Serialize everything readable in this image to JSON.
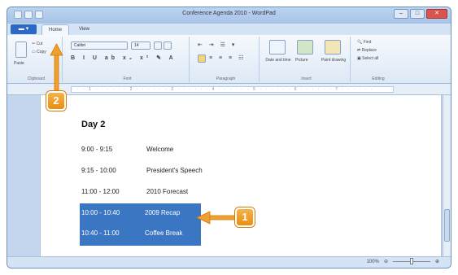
{
  "window": {
    "title": "Conference Agenda 2010 - WordPad"
  },
  "tabs": [
    "Home",
    "View"
  ],
  "app_button": "▬ ▾",
  "ribbon": {
    "clipboard": {
      "paste": "Paste",
      "cut": "Cut",
      "copy": "Copy",
      "label": "Clipboard"
    },
    "font": {
      "name": "Calibri",
      "size": "14",
      "label": "Font"
    },
    "paragraph": {
      "label": "Paragraph"
    },
    "insert": {
      "datetime": "Date and time",
      "picture": "Picture",
      "paint": "Paint drawing",
      "label": "Insert"
    },
    "editing": {
      "find": "Find",
      "replace": "Replace",
      "select_all": "Select all",
      "label": "Editing"
    }
  },
  "document": {
    "heading": "Day 2",
    "rows": [
      {
        "time": "9:00 - 9:15",
        "event": "Welcome"
      },
      {
        "time": "9:15 - 10:00",
        "event": "President's Speech"
      },
      {
        "time": "11:00 - 12:00",
        "event": "2010 Forecast"
      },
      {
        "time": "10:00 - 10:40",
        "event": "2009 Recap"
      },
      {
        "time": "10:40 - 11:00",
        "event": "Coffee Break"
      }
    ]
  },
  "status": {
    "zoom": "100%"
  },
  "callouts": {
    "one": "1",
    "two": "2"
  },
  "colors": {
    "selection": "#3b76c3",
    "callout": "#f0a030"
  }
}
